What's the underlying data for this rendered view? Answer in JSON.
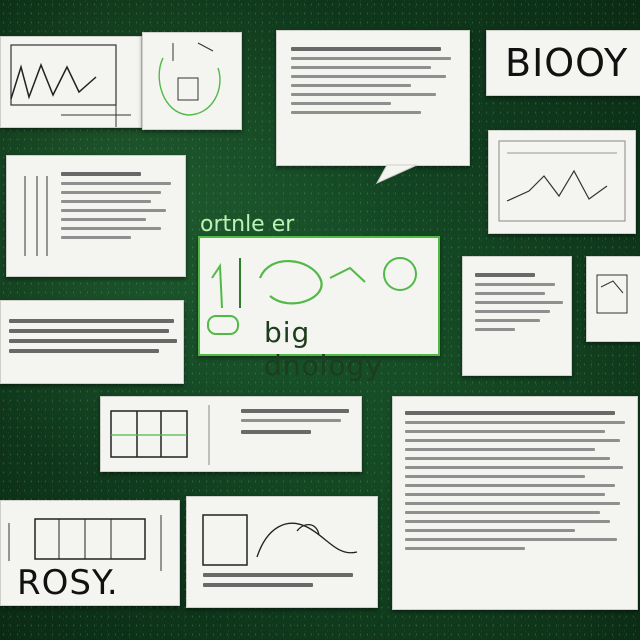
{
  "texts": {
    "biology_top": "BIOOY",
    "center_heading": "ortnle er",
    "center_label": "big dnology",
    "bottom_left": "ROSY."
  },
  "colors": {
    "background": "#0f3a1d",
    "card": "#f4f4f1",
    "ink_green": "#52b947",
    "label_green": "#bdf2b5"
  }
}
